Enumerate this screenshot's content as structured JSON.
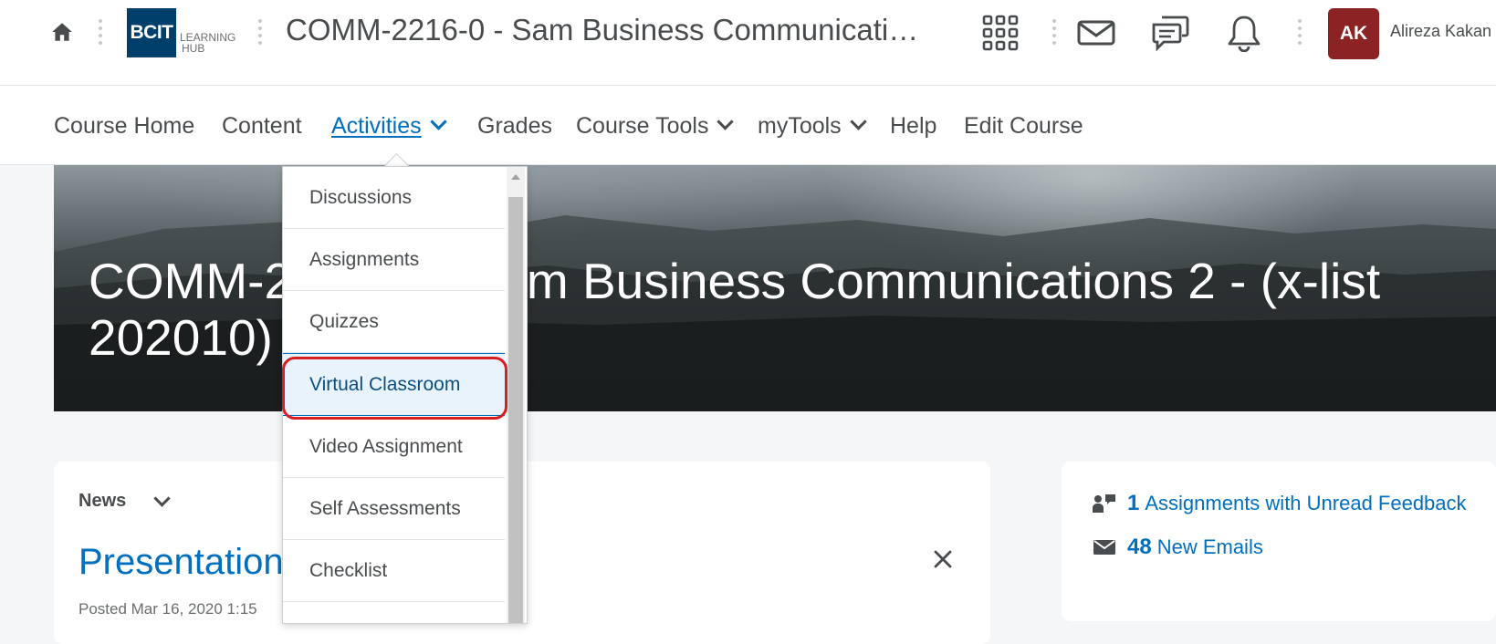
{
  "header": {
    "logo_main": "BCIT",
    "logo_tm": "™",
    "logo_sub_line1": "LEARNING",
    "logo_sub_line2": "HUB",
    "course_title": "COMM-2216-0 - Sam Business Communicati…",
    "avatar_initials": "AK",
    "user_name": "Alireza Kakan"
  },
  "nav": {
    "items": [
      {
        "label": "Course Home"
      },
      {
        "label": "Content"
      },
      {
        "label": "Activities"
      },
      {
        "label": "Grades"
      },
      {
        "label": "Course Tools"
      },
      {
        "label": "myTools"
      },
      {
        "label": "Help"
      },
      {
        "label": "Edit Course"
      }
    ]
  },
  "banner": {
    "title": "COMM-2216-0 - Sam Business Communications 2 - (x-list 202010)"
  },
  "dropdown": {
    "items": [
      {
        "label": "Discussions"
      },
      {
        "label": "Assignments"
      },
      {
        "label": "Quizzes"
      },
      {
        "label": "Virtual Classroom"
      },
      {
        "label": "Video Assignment"
      },
      {
        "label": "Self Assessments"
      },
      {
        "label": "Checklist"
      }
    ]
  },
  "news": {
    "label": "News",
    "headline": "Presentation",
    "posted": "Posted Mar 16, 2020 1:15"
  },
  "updates": {
    "feedback_count": "1",
    "feedback_label": "Assignments with Unread Feedback",
    "email_count": "48",
    "email_label": "New Emails"
  },
  "colors": {
    "link": "#006fbf",
    "brand": "#003e6b",
    "avatar": "#8b2324",
    "annotation": "#d81e23"
  }
}
